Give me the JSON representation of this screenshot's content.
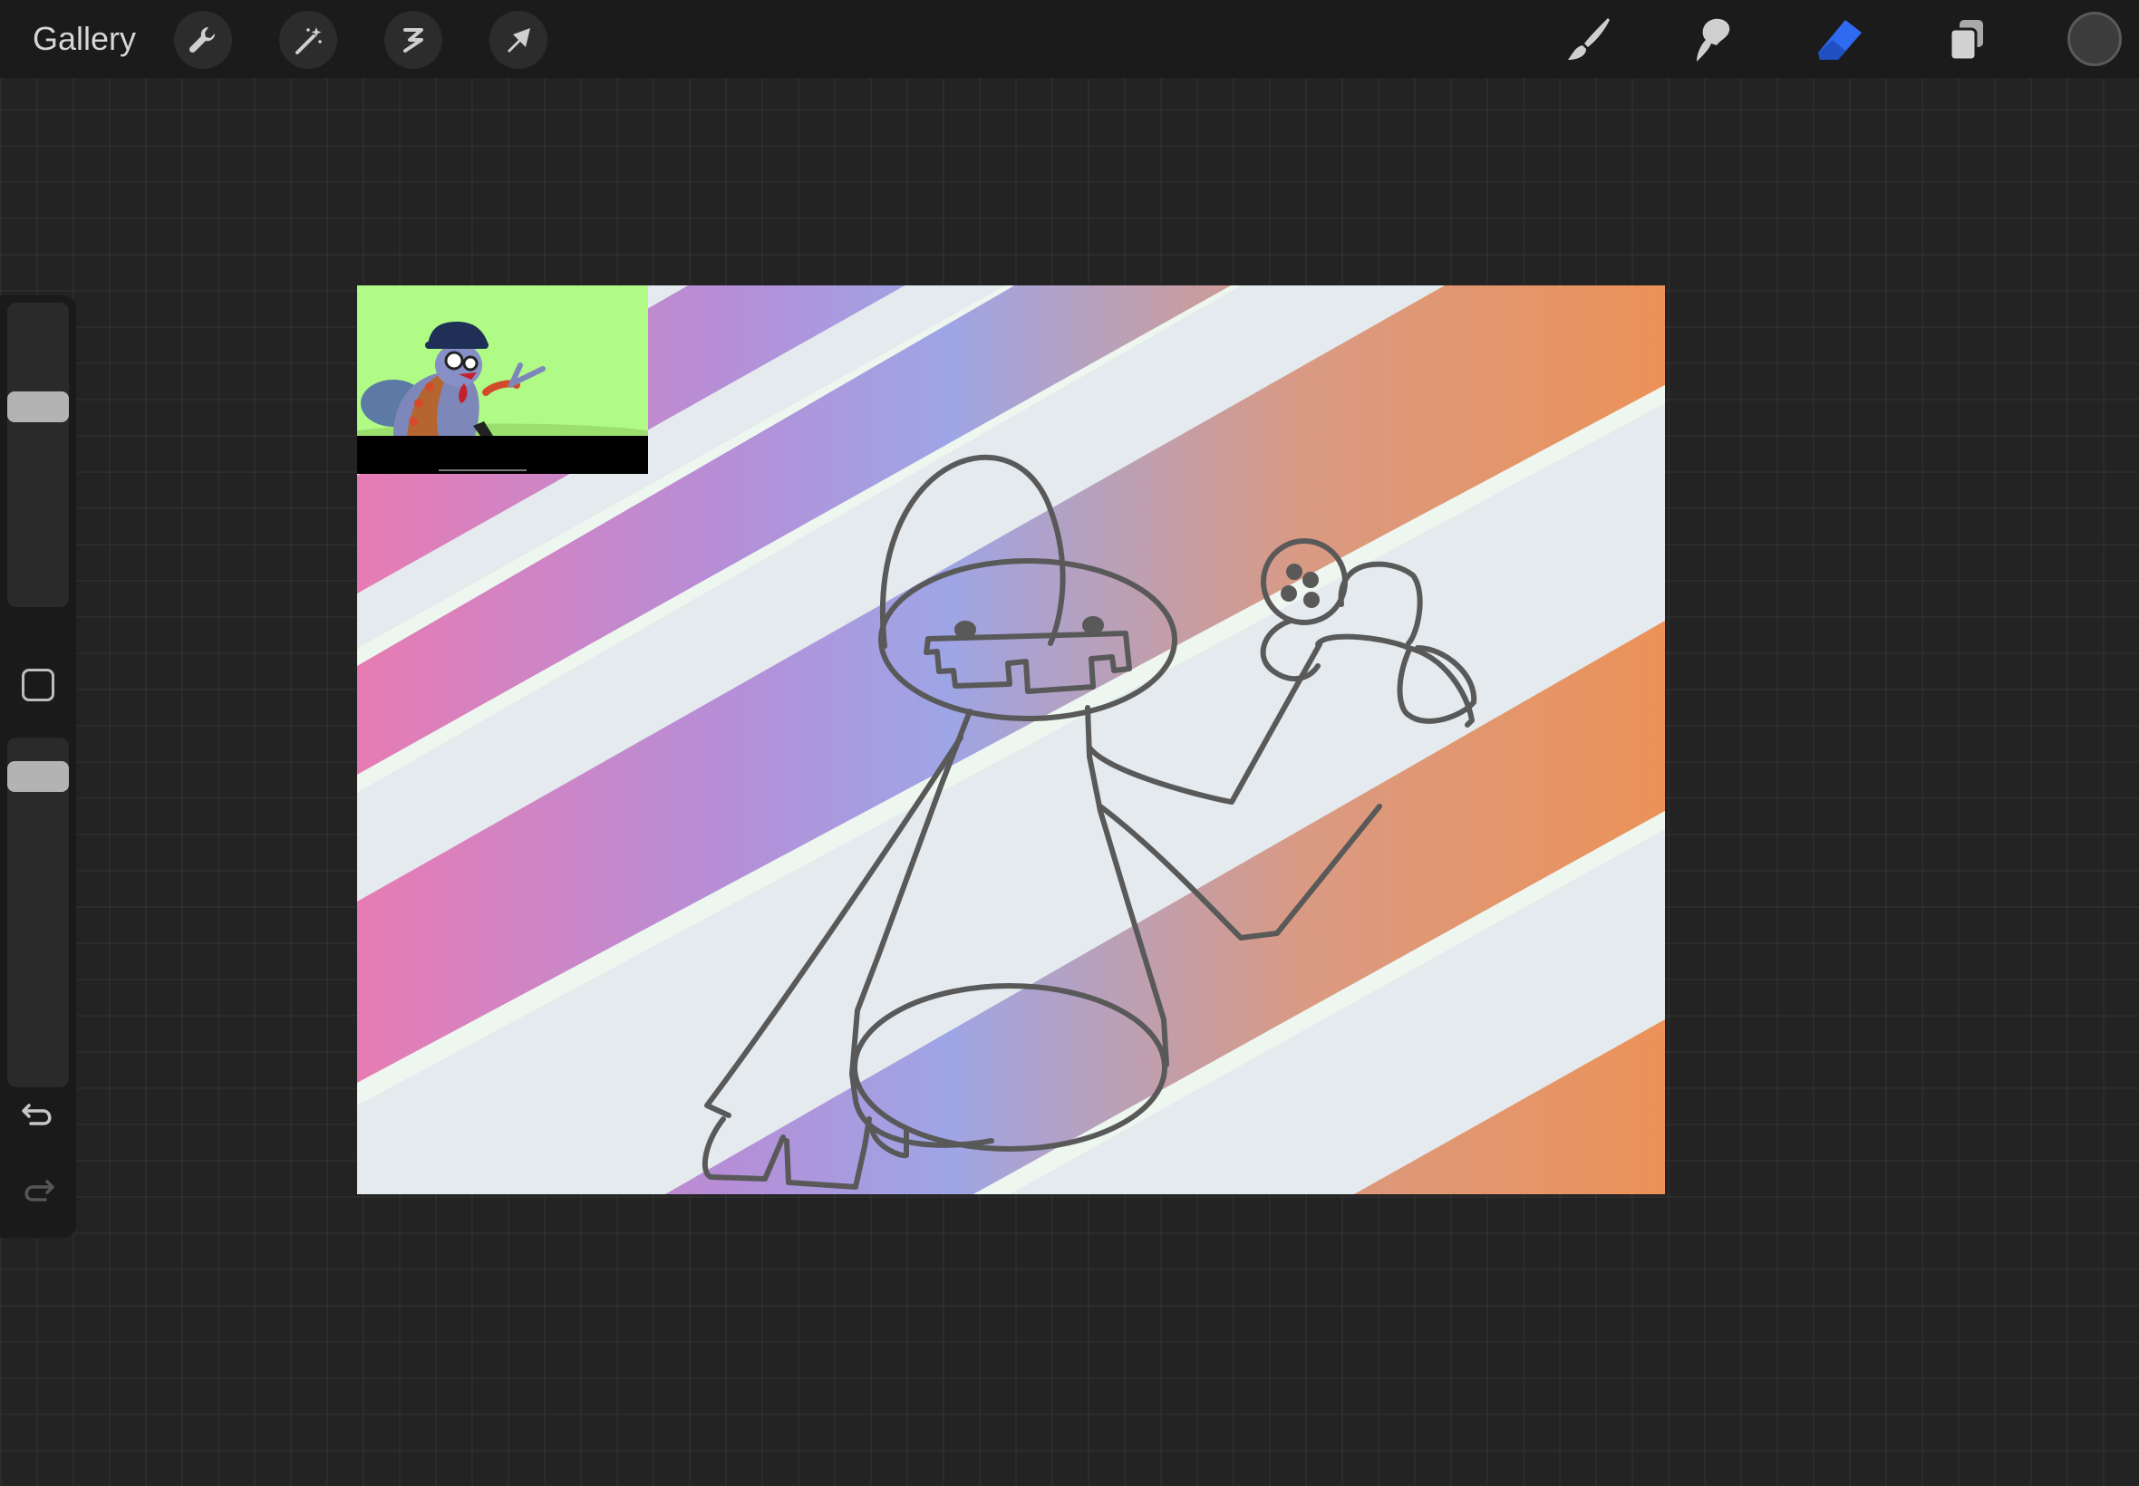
{
  "topbar": {
    "gallery_label": "Gallery",
    "left_tools": [
      {
        "icon": "wrench-icon",
        "name": "actions"
      },
      {
        "icon": "magic-wand-icon",
        "name": "adjustments"
      },
      {
        "icon": "selection-icon",
        "name": "selection"
      },
      {
        "icon": "arrow-cursor-icon",
        "name": "transform"
      }
    ],
    "right_tools": [
      {
        "icon": "brush-icon",
        "name": "brush"
      },
      {
        "icon": "smudge-icon",
        "name": "smudge"
      },
      {
        "icon": "eraser-icon",
        "name": "eraser",
        "active": true
      },
      {
        "icon": "layers-icon",
        "name": "layers"
      }
    ],
    "active_color": "#3c3c3c",
    "accent_color": "#2f6bf0"
  },
  "sidebar": {
    "brush_size_level": 0.35,
    "opacity_level": 0.9,
    "icons": [
      "square-modify-icon",
      "undo-icon",
      "redo-icon"
    ]
  },
  "canvas": {
    "background_stripes": [
      "#e4eaed",
      "#edf5ef"
    ],
    "gradient_colors": [
      "#e77bb3",
      "#b68ed7",
      "#9ea5e6",
      "#d99a84",
      "#ec9258"
    ],
    "line_color": "#5a5a5a",
    "reference_image": {
      "background": "#b0fb86"
    }
  }
}
